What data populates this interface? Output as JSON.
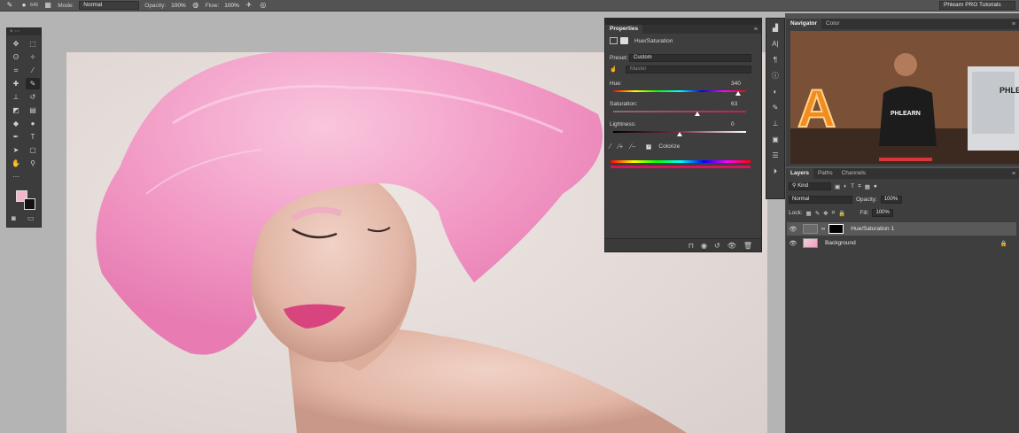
{
  "options_bar": {
    "brush_size": "645",
    "mode_label": "Mode:",
    "mode_value": "Normal",
    "opacity_label": "Opacity:",
    "opacity_value": "100%",
    "flow_label": "Flow:",
    "flow_value": "100%",
    "workspace": "Phlearn PRO Tutorials"
  },
  "properties": {
    "tab": "Properties",
    "adjustment_name": "Hue/Saturation",
    "preset_label": "Preset:",
    "preset_value": "Custom",
    "channel_value": "Master",
    "hue_label": "Hue:",
    "hue_value": "340",
    "hue_fraction": 0.94,
    "saturation_label": "Saturation:",
    "saturation_value": "63",
    "saturation_fraction": 0.63,
    "lightness_label": "Lightness:",
    "lightness_value": "0",
    "lightness_fraction": 0.5,
    "colorize_label": "Colorize",
    "colorize_checked": true
  },
  "navigator": {
    "tab_navigator": "Navigator",
    "tab_color": "Color",
    "preview_text": "PHLEARN",
    "preview_sign": "A"
  },
  "layers": {
    "tab_layers": "Layers",
    "tab_paths": "Paths",
    "tab_channels": "Channels",
    "filter_kind": "Kind",
    "blend_mode": "Normal",
    "opacity_label": "Opacity:",
    "opacity_value": "100%",
    "lock_label": "Lock:",
    "fill_label": "Fill:",
    "fill_value": "100%",
    "items": [
      {
        "name": "Hue/Saturation 1",
        "selected": true
      },
      {
        "name": "Background",
        "selected": false
      }
    ]
  },
  "colors": {
    "foreground": "#f4b7ca",
    "background": "#111111",
    "hair": "#f08fbf"
  }
}
